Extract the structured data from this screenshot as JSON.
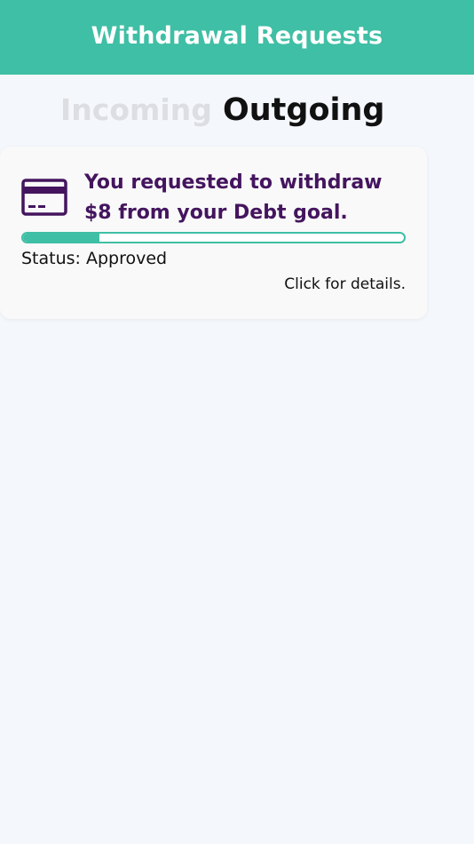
{
  "header": {
    "title": "Withdrawal Requests"
  },
  "tabs": [
    {
      "label": "Incoming",
      "active": false
    },
    {
      "label": "Outgoing",
      "active": true
    }
  ],
  "requests": [
    {
      "icon": "credit-card-icon",
      "message": "You requested to withdraw $8 from your Debt goal.",
      "progress": 0.2,
      "status": "Status: Approved",
      "details_link": "Click for details."
    }
  ],
  "colors": {
    "accent": "#3fbfa5",
    "message_text": "#44155e",
    "inactive_tab": "#dcdee2",
    "background": "#f4f7fb"
  }
}
